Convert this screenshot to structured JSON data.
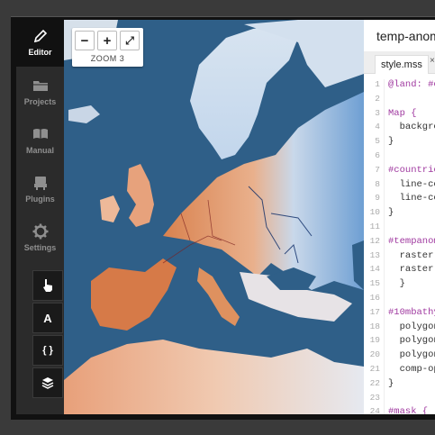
{
  "sidebar": {
    "items": [
      {
        "label": "Editor",
        "icon": "pencil-icon"
      },
      {
        "label": "Projects",
        "icon": "folder-icon"
      },
      {
        "label": "Manual",
        "icon": "book-icon"
      },
      {
        "label": "Plugins",
        "icon": "plugin-icon"
      },
      {
        "label": "Settings",
        "icon": "gear-icon"
      }
    ],
    "tools": [
      {
        "label": "",
        "icon": "hand-pointer-icon"
      },
      {
        "label": "A",
        "icon": "font-icon"
      },
      {
        "label": "{ }",
        "icon": "braces-icon"
      },
      {
        "label": "",
        "icon": "layers-icon"
      }
    ]
  },
  "map": {
    "zoom_label": "ZOOM 3",
    "zoom_in": "+",
    "zoom_out": "−",
    "fullscreen": "⤢"
  },
  "editor": {
    "title": "temp-anom",
    "tab_label": "style.mss",
    "tab_close": "×",
    "lines": [
      {
        "n": "1",
        "text": "@land: #e"
      },
      {
        "n": "2",
        "text": ""
      },
      {
        "n": "3",
        "text": "Map {"
      },
      {
        "n": "4",
        "text": "  backgro"
      },
      {
        "n": "5",
        "text": "}"
      },
      {
        "n": "6",
        "text": ""
      },
      {
        "n": "7",
        "text": "#countrie"
      },
      {
        "n": "8",
        "text": "  line-co"
      },
      {
        "n": "9",
        "text": "  line-co"
      },
      {
        "n": "10",
        "text": "}"
      },
      {
        "n": "11",
        "text": ""
      },
      {
        "n": "12",
        "text": "#tempanom"
      },
      {
        "n": "13",
        "text": "  raster-"
      },
      {
        "n": "14",
        "text": "  raster-"
      },
      {
        "n": "15",
        "text": "  }"
      },
      {
        "n": "16",
        "text": ""
      },
      {
        "n": "17",
        "text": "#10mbathy"
      },
      {
        "n": "18",
        "text": "  polygon"
      },
      {
        "n": "19",
        "text": "  polygon"
      },
      {
        "n": "20",
        "text": "  polygon"
      },
      {
        "n": "21",
        "text": "  comp-op"
      },
      {
        "n": "22",
        "text": "}"
      },
      {
        "n": "23",
        "text": ""
      },
      {
        "n": "24",
        "text": "#mask {"
      }
    ]
  },
  "colors": {
    "sea": "#2f5f88",
    "land_warm": "#d9824f",
    "land_cold": "#7aa6d6",
    "selector": "#a03aa0"
  }
}
